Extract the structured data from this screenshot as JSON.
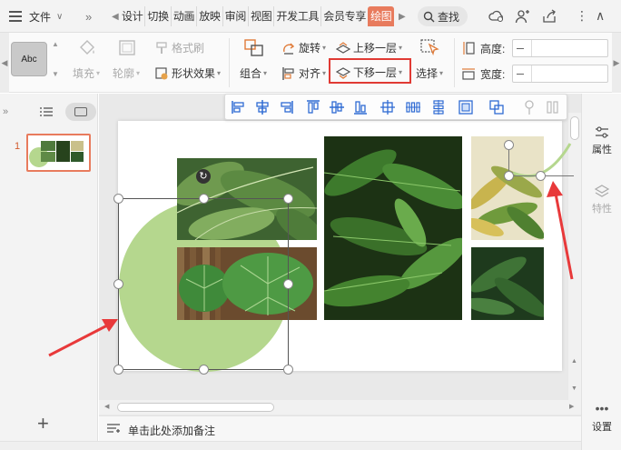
{
  "menubar": {
    "file_label": "文件",
    "tabs": [
      "设计",
      "切换",
      "动画",
      "放映",
      "审阅",
      "视图",
      "开发工具",
      "会员专享",
      "绘图"
    ],
    "active_tab": "绘图",
    "search_label": "查找"
  },
  "ribbon": {
    "style_preview_label": "Abc",
    "fill_label": "填充",
    "outline_label": "轮廓",
    "format_brush_label": "格式刷",
    "shape_effect_label": "形状效果",
    "group_label": "组合",
    "rotate_label": "旋转",
    "align_label": "对齐",
    "bring_forward_label": "上移一层",
    "send_backward_label": "下移一层",
    "select_label": "选择",
    "height_label": "高度:",
    "width_label": "宽度:"
  },
  "left_pane": {
    "slide_number": "1"
  },
  "notes": {
    "placeholder": "单击此处添加备注"
  },
  "right_pane": {
    "property_label": "属性",
    "feature_label": "特性",
    "settings_label": "设置"
  },
  "colors": {
    "accent": "#e87b5d",
    "highlight_red": "#e03a34",
    "circle_green": "#b5d78e",
    "arrow_red": "#e8393a"
  }
}
